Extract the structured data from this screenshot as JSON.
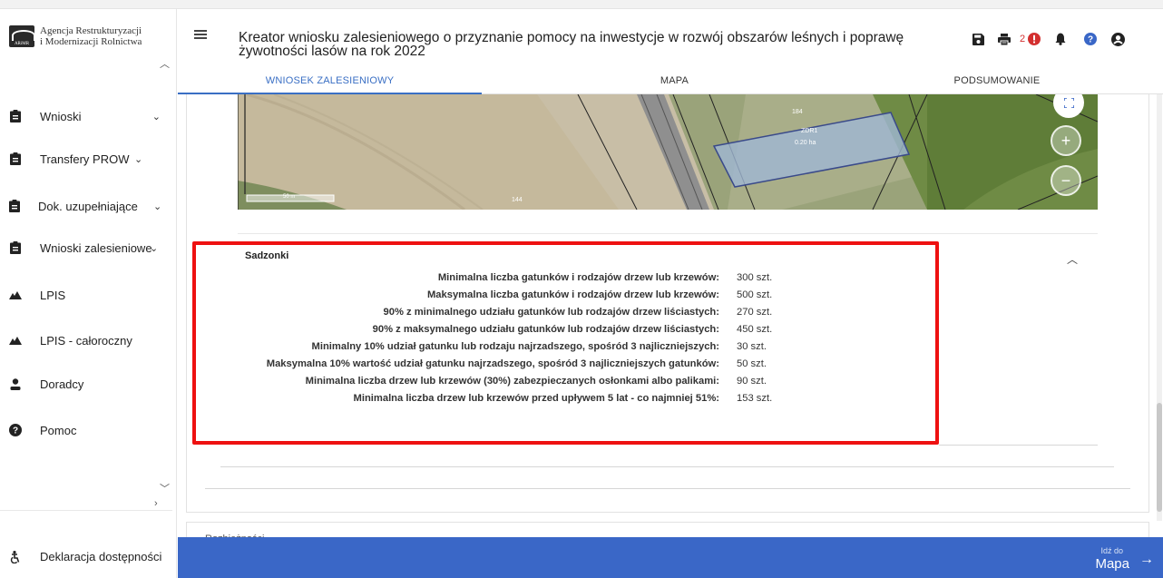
{
  "sidebar": {
    "logo_line1": "Agencja Restrukturyzacji",
    "logo_line2": "i Modernizacji Rolnictwa",
    "logo_mark_text": "ARiMR",
    "items": [
      {
        "label": "Wnioski",
        "icon": "clipboard-icon",
        "chevron": "⌄"
      },
      {
        "label": "Transfery PROW",
        "icon": "clipboard-icon",
        "chevron": "⌄"
      },
      {
        "label": "Dok. uzupełniające",
        "icon": "clipboard-icon",
        "chevron": "⌄"
      },
      {
        "label": "Wnioski zalesieniowe",
        "icon": "clipboard-icon",
        "chevron": "⌄"
      },
      {
        "label": "LPIS",
        "icon": "mountain-icon"
      },
      {
        "label": "LPIS - całoroczny",
        "icon": "mountain-icon"
      },
      {
        "label": "Doradcy",
        "icon": "person-icon"
      },
      {
        "label": "Pomoc",
        "icon": "question-icon"
      }
    ],
    "accessibility": "Deklaracja dostępności"
  },
  "header": {
    "title": "Kreator wniosku zalesieniowego o przyznanie pomocy na inwestycje w rozwój obszarów leśnych i poprawę żywotności lasów na rok 2022",
    "error_count": "2",
    "icons": [
      "save-icon",
      "print-icon",
      "error-badge-icon",
      "bell-icon",
      "help-icon",
      "user-icon"
    ]
  },
  "tabs": [
    {
      "label": "WNIOSEK ZALESIENIOWY",
      "active": true
    },
    {
      "label": "MAPA",
      "active": false
    },
    {
      "label": "PODSUMOWANIE",
      "active": false
    }
  ],
  "map": {
    "scale_label": "50 m",
    "parcel_labels": [
      "184",
      "ZDR1",
      "0.20 ha",
      "144"
    ]
  },
  "section": {
    "title": "Sadzonki",
    "rows": [
      {
        "label": "Minimalna liczba gatunków i rodzajów drzew lub krzewów:",
        "value": "300 szt."
      },
      {
        "label": "Maksymalna liczba gatunków i rodzajów drzew lub krzewów:",
        "value": "500 szt."
      },
      {
        "label": "90% z minimalnego udziału gatunków lub rodzajów drzew liściastych:",
        "value": "270 szt."
      },
      {
        "label": "90% z maksymalnego udziału gatunków lub rodzajów drzew liściastych:",
        "value": "450 szt."
      },
      {
        "label": "Minimalny 10% udział gatunku lub rodzaju najrzadszego, spośród 3 najliczniejszych:",
        "value": "30 szt."
      },
      {
        "label": "Maksymalna 10% wartość udział gatunku najrzadszego, spośród 3 najliczniejszych gatunków:",
        "value": "50 szt."
      },
      {
        "label": "Minimalna liczba drzew lub krzewów (30%) zabezpieczanych osłonkami albo palikami:",
        "value": "90 szt."
      },
      {
        "label": "Minimalna liczba drzew lub krzewów przed upływem 5 lat - co najmniej 51%:",
        "value": "153 szt."
      }
    ]
  },
  "next_section": {
    "title": "Rozbieżności"
  },
  "footer": {
    "next_small": "Idź do",
    "next_big": "Mapa"
  },
  "colors": {
    "accent": "#3a67c7",
    "highlight": "#ee1111",
    "error": "#d32f2f"
  }
}
